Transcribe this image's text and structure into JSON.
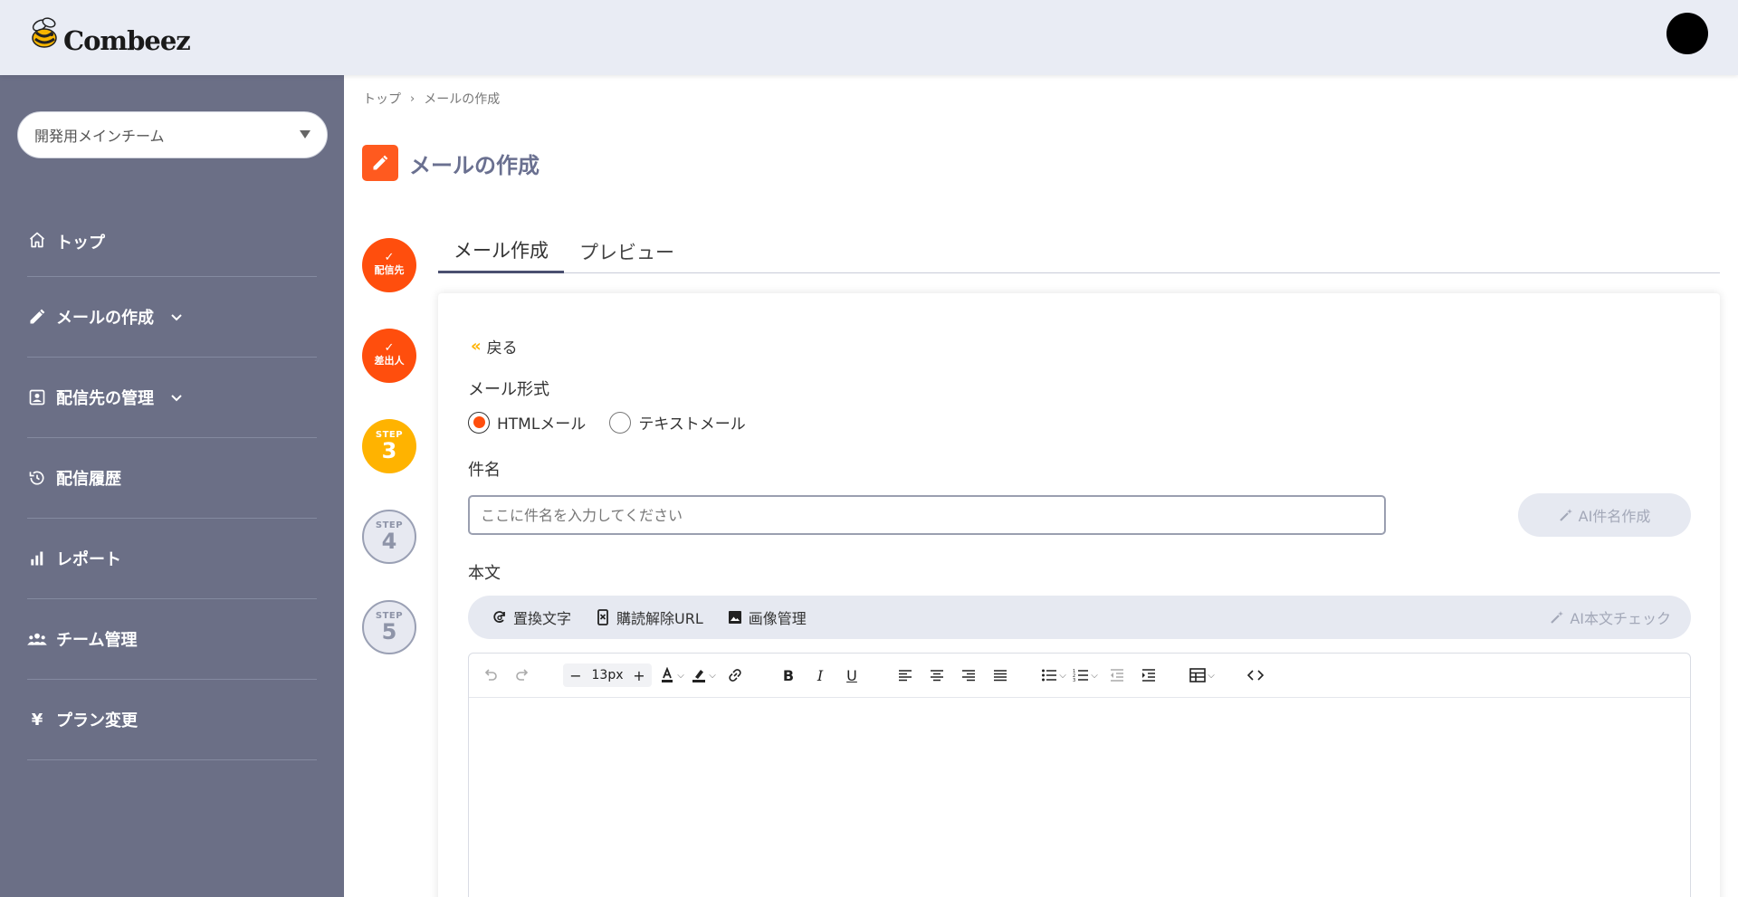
{
  "header": {
    "logo_text": "Combeez"
  },
  "sidebar": {
    "team_select": "開発用メインチーム",
    "items": [
      {
        "label": "トップ",
        "icon": "home-icon",
        "expandable": false
      },
      {
        "label": "メールの作成",
        "icon": "pencil-icon",
        "expandable": true
      },
      {
        "label": "配信先の管理",
        "icon": "contacts-icon",
        "expandable": true
      },
      {
        "label": "配信履歴",
        "icon": "history-icon",
        "expandable": false
      },
      {
        "label": "レポート",
        "icon": "bar-chart-icon",
        "expandable": false
      },
      {
        "label": "チーム管理",
        "icon": "team-icon",
        "expandable": false
      },
      {
        "label": "プラン変更",
        "icon": "yen-icon",
        "expandable": false
      }
    ]
  },
  "breadcrumb": {
    "home": "トップ",
    "current": "メールの作成"
  },
  "page": {
    "title": "メールの作成"
  },
  "steps": [
    {
      "state": "done",
      "label": "配信先"
    },
    {
      "state": "done",
      "label": "差出人"
    },
    {
      "state": "current",
      "step_text": "STEP",
      "number": "3"
    },
    {
      "state": "todo",
      "step_text": "STEP",
      "number": "4"
    },
    {
      "state": "todo",
      "step_text": "STEP",
      "number": "5"
    }
  ],
  "tabs": [
    {
      "label": "メール作成",
      "active": true
    },
    {
      "label": "プレビュー",
      "active": false
    }
  ],
  "form": {
    "back_label": "戻る",
    "format_label": "メール形式",
    "format_options": [
      {
        "label": "HTMLメール",
        "selected": true
      },
      {
        "label": "テキストメール",
        "selected": false
      }
    ],
    "subject_label": "件名",
    "subject_placeholder": "ここに件名を入力してください",
    "subject_value": "",
    "ai_subject_button": "AI件名作成",
    "body_label": "本文",
    "body_tools": {
      "replace_text": "置換文字",
      "unsubscribe_url": "購読解除URL",
      "image_manage": "画像管理",
      "ai_check": "AI本文チェック"
    }
  },
  "editor": {
    "font_size": "13px"
  },
  "colors": {
    "accent_orange": "#ff4e0d",
    "step_current": "#ffb300",
    "sidebar_bg": "#6b6f86",
    "header_bg": "#e9ecf4"
  }
}
